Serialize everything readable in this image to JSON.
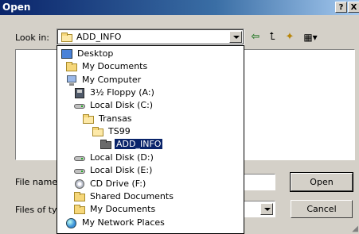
{
  "window": {
    "title": "Open",
    "help_glyph": "?",
    "close_glyph": "X"
  },
  "lookin": {
    "label": "Look in:",
    "value": "ADD_INFO"
  },
  "toolbar": {
    "back_glyph": "⇦",
    "up_glyph": "⮤",
    "newfolder_glyph": "✦",
    "views_glyph": "▦▾"
  },
  "filename": {
    "label": "File name:",
    "value": ""
  },
  "filetype": {
    "label": "Files of type:",
    "value": ""
  },
  "buttons": {
    "open": "Open",
    "cancel": "Cancel"
  },
  "dropdown_items": [
    {
      "label": "Desktop",
      "icon": "desktop-icon"
    },
    {
      "label": "My Documents",
      "icon": "folder-icon"
    },
    {
      "label": "My Computer",
      "icon": "computer-icon"
    },
    {
      "label": "3½ Floppy (A:)",
      "icon": "floppy-icon"
    },
    {
      "label": "Local Disk (C:)",
      "icon": "disk-icon"
    },
    {
      "label": "Transas",
      "icon": "folder-open-icon"
    },
    {
      "label": "TS99",
      "icon": "folder-open-icon"
    },
    {
      "label": "ADD_INFO",
      "icon": "folder-selected-icon",
      "selected": true
    },
    {
      "label": "Local Disk (D:)",
      "icon": "disk-icon"
    },
    {
      "label": "Local Disk (E:)",
      "icon": "disk-icon"
    },
    {
      "label": "CD Drive (F:)",
      "icon": "cd-icon"
    },
    {
      "label": "Shared Documents",
      "icon": "folder-icon"
    },
    {
      "label": "My Documents",
      "icon": "folder-icon"
    },
    {
      "label": "My Network Places",
      "icon": "network-icon"
    }
  ],
  "colors": {
    "title_bar": "#0a246a",
    "face": "#d4d0c8",
    "selection": "#0a246a"
  }
}
